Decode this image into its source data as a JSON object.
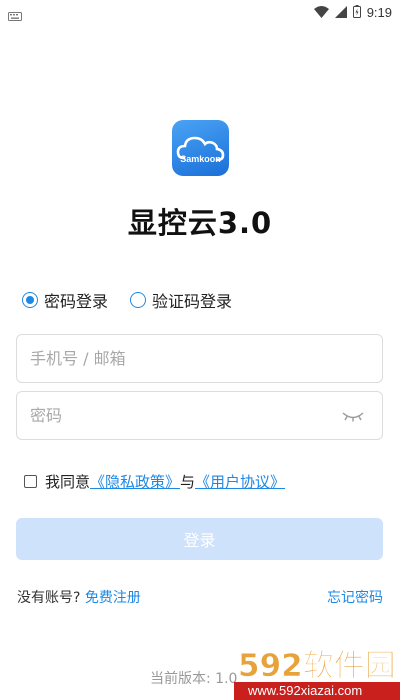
{
  "status_bar": {
    "time": "9:19",
    "icons": [
      "keyboard-icon",
      "wifi-icon",
      "signal-icon",
      "battery-icon"
    ]
  },
  "app": {
    "logo_text": "Samkoon",
    "title": "显控云3.0",
    "brand_color": "#1e88e5"
  },
  "login_modes": [
    {
      "label": "密码登录",
      "selected": true
    },
    {
      "label": "验证码登录",
      "selected": false
    }
  ],
  "fields": {
    "account": {
      "placeholder": "手机号 / 邮箱",
      "value": ""
    },
    "password": {
      "placeholder": "密码",
      "value": ""
    }
  },
  "agreement": {
    "prefix": "我同意",
    "privacy": "《隐私政策》",
    "and": "与",
    "terms": "《用户协议》",
    "checked": false
  },
  "login_button": "登录",
  "footer": {
    "no_account": "没有账号?",
    "register": "免费注册",
    "forgot": "忘记密码"
  },
  "version": "当前版本: 1.0",
  "watermark": {
    "big": "592软件园",
    "url": "www.592xiazai.com"
  }
}
